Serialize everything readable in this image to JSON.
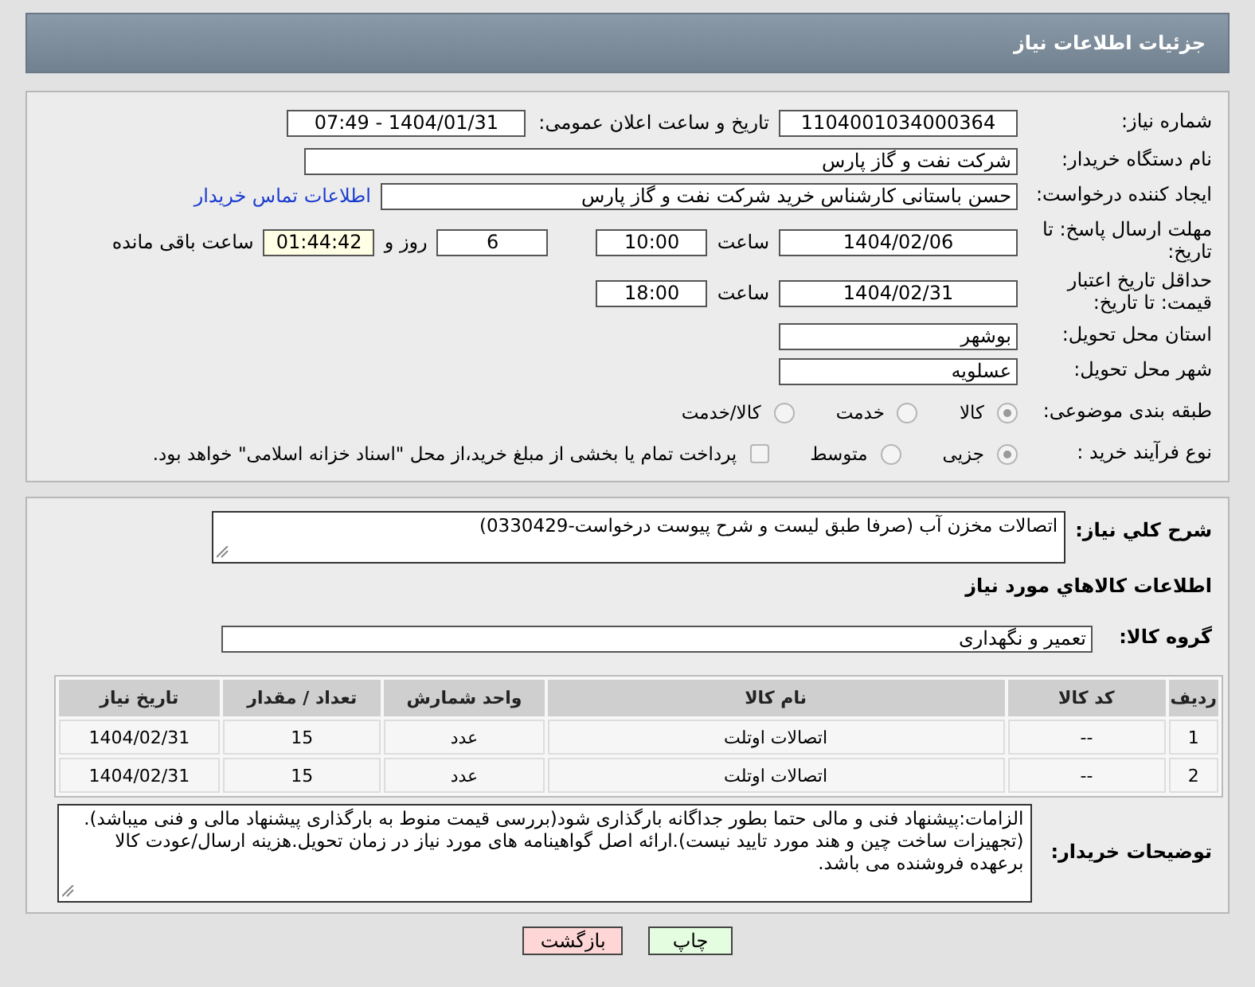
{
  "header": {
    "title": "جزئیات اطلاعات نیاز"
  },
  "need_number": {
    "label": "شماره نیاز:",
    "value": "1104001034000364"
  },
  "announce": {
    "label": "تاریخ و ساعت اعلان عمومی:",
    "value": "1404/01/31 - 07:49"
  },
  "buyer": {
    "label": "نام دستگاه خریدار:",
    "value": "شرکت نفت و گاز پارس"
  },
  "creator": {
    "label": "ایجاد کننده درخواست:",
    "value": "حسن باستانی کارشناس خرید شرکت نفت و گاز پارس",
    "link": "اطلاعات تماس خریدار"
  },
  "deadline": {
    "label": "مهلت ارسال پاسخ: تا تاریخ:",
    "date": "1404/02/06",
    "time_label": "ساعت",
    "time": "10:00",
    "days": "6",
    "days_label": "روز و",
    "remaining": "01:44:42",
    "remaining_label": "ساعت باقی مانده"
  },
  "validity": {
    "label": "حداقل تاریخ اعتبار قیمت: تا تاریخ:",
    "date": "1404/02/31",
    "time_label": "ساعت",
    "time": "18:00"
  },
  "province": {
    "label": "استان محل تحویل:",
    "value": "بوشهر"
  },
  "city": {
    "label": "شهر محل تحویل:",
    "value": "عسلویه"
  },
  "category": {
    "label": "طبقه بندی موضوعی:",
    "options": [
      {
        "label": "کالا",
        "selected": true
      },
      {
        "label": "خدمت",
        "selected": false
      },
      {
        "label": "کالا/خدمت",
        "selected": false
      }
    ]
  },
  "process": {
    "label": "نوع فرآیند خرید :",
    "options": [
      {
        "label": "جزیی",
        "selected": true
      },
      {
        "label": "متوسط",
        "selected": false
      }
    ],
    "payment": {
      "checked": false,
      "text": "پرداخت تمام یا بخشی از مبلغ خرید،از محل \"اسناد خزانه اسلامی\" خواهد بود."
    }
  },
  "description": {
    "label": "شرح کلي نياز:",
    "value": "اتصالات مخزن آب (صرفا طبق لیست و شرح پیوست درخواست-0330429)"
  },
  "goods_heading": "اطلاعات کالاهاي مورد نياز",
  "goods_group": {
    "label": "گروه کالا:",
    "value": "تعمیر و نگهداری"
  },
  "table": {
    "columns": [
      "ردیف",
      "کد کالا",
      "نام کالا",
      "واحد شمارش",
      "تعداد / مقدار",
      "تاریخ نیاز"
    ],
    "rows": [
      [
        "1",
        "--",
        "اتصالات اوتلت",
        "عدد",
        "15",
        "1404/02/31"
      ],
      [
        "2",
        "--",
        "اتصالات اوتلت",
        "عدد",
        "15",
        "1404/02/31"
      ]
    ]
  },
  "buyer_notes": {
    "label": "توضیحات خریدار:",
    "value": "الزامات:پیشنهاد فنی و مالی حتما  بطور جداگانه بارگذاری شود(بررسی قیمت منوط به بارگذاری پیشنهاد مالی و فنی میباشد).(تجهیزات ساخت چین و هند مورد تایید نیست).ارائه اصل گواهینامه های مورد نیاز در زمان تحویل.هزینه ارسال/عودت کالا برعهده فروشنده می باشد."
  },
  "buttons": [
    {
      "label": "چاپ",
      "kind": "print"
    },
    {
      "label": "بازگشت",
      "kind": "back"
    }
  ]
}
